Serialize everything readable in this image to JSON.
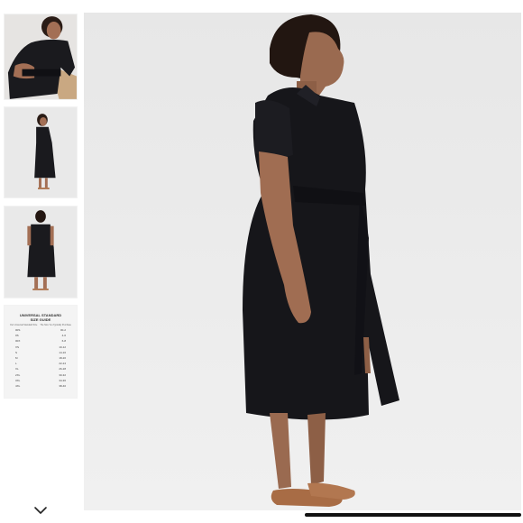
{
  "gallery": {
    "thumbnails": [
      {
        "kind": "photo",
        "view": "closeup"
      },
      {
        "kind": "photo",
        "view": "front"
      },
      {
        "kind": "photo",
        "view": "back"
      },
      {
        "kind": "size-guide"
      }
    ],
    "more_icon": "chevron-down-icon"
  },
  "size_guide": {
    "title_line1": "UNIVERSAL STANDARD",
    "title_line2": "SIZE GUIDE",
    "col_left": "Our Universal Standard Size",
    "col_right": "The Size You Typically Purchase",
    "rows": [
      [
        "00S",
        "00-2"
      ],
      [
        "0S",
        "4-6"
      ],
      [
        "00X",
        "6-8"
      ],
      [
        "XS",
        "10-12"
      ],
      [
        "S",
        "14-16"
      ],
      [
        "M",
        "18-20"
      ],
      [
        "L",
        "22-24"
      ],
      [
        "XL",
        "26-28"
      ],
      [
        "2XL",
        "30-32"
      ],
      [
        "3XL",
        "34-36"
      ],
      [
        "4XL",
        "38-40"
      ]
    ]
  },
  "colors": {
    "dress": "#16161a",
    "background": "#ececec",
    "skin": "#9a6a50"
  }
}
